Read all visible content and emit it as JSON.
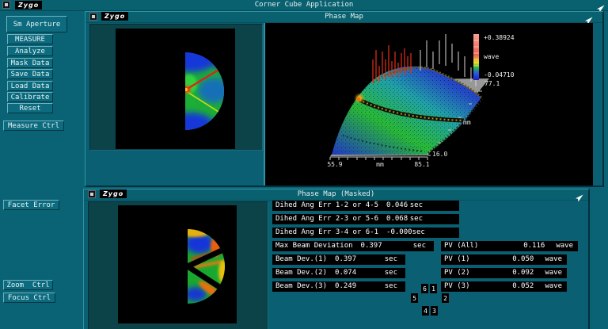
{
  "app": {
    "title": "Corner Cube Application",
    "logo": "Zygo"
  },
  "colors": {
    "background": "#0A6374",
    "titlebar": "#09616F",
    "sunken_panel": "#0B4348",
    "accent_border": "#2F93A6",
    "plot_background": "#000000",
    "text": "#FFFFFF"
  },
  "sidebar": {
    "sm_aperture": "Sm Aperture",
    "buttons": [
      "MEASURE",
      "Analyze",
      "Mask Data",
      "Save Data",
      "Load Data",
      "Calibrate",
      "Reset"
    ],
    "measure_ctrl": "Measure Ctrl",
    "facet_error": "Facet Error",
    "zoom_ctrl": "Zoom  Ctrl",
    "focus_ctrl": "Focus Ctrl"
  },
  "phase_map_window": {
    "title": "Phase Map",
    "plot": {
      "colorbar_max": "+0.38924",
      "colorbar_unit": "wave",
      "colorbar_min": "-0.04710",
      "z_corner": "77.1",
      "x_min": "55.9",
      "x_unit": "mm",
      "x_max": "85.1",
      "y_min": "16.0",
      "y_unit": "mm"
    }
  },
  "masked_window": {
    "title": "Phase Map (Masked)",
    "stats_left": [
      {
        "label": "Dihed Ang Err 1-2 or 4-5",
        "value": "0.046",
        "unit": "sec"
      },
      {
        "label": "Dihed Ang Err 2-3 or 5-6",
        "value": "0.068",
        "unit": "sec"
      },
      {
        "label": "Dihed Ang Err 3-4 or 6-1",
        "value": "-0.000",
        "unit": "sec"
      },
      {
        "label": "Max Beam Deviation",
        "value": "0.397",
        "unit": "sec"
      },
      {
        "label": "Beam Dev.(1)",
        "value": "0.397",
        "unit": "sec"
      },
      {
        "label": "Beam Dev.(2)",
        "value": "0.074",
        "unit": "sec"
      },
      {
        "label": "Beam Dev.(3)",
        "value": "0.249",
        "unit": "sec"
      }
    ],
    "stats_right": [
      {
        "label": "PV (All)",
        "value": "0.116",
        "unit": "wave"
      },
      {
        "label": "PV (1)",
        "value": "0.050",
        "unit": "wave"
      },
      {
        "label": "PV (2)",
        "value": "0.092",
        "unit": "wave"
      },
      {
        "label": "PV (3)",
        "value": "0.052",
        "unit": "wave"
      }
    ],
    "segment_labels": [
      "6",
      "1",
      "5",
      "2",
      "4",
      "3"
    ]
  }
}
